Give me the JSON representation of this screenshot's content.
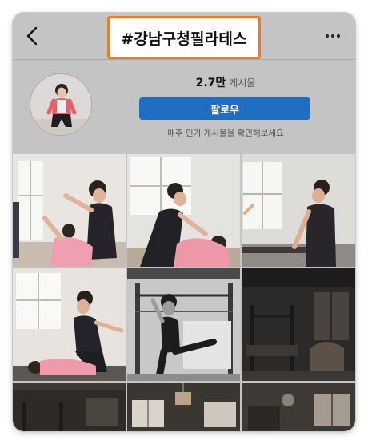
{
  "header": {
    "hashtag_title": "#강남구청필라테스",
    "back_icon": "chevron-left-icon",
    "more_icon": "more-horizontal-icon",
    "highlight_color": "#f47a20"
  },
  "profile": {
    "post_count": "2.7만",
    "post_label": "게시물",
    "follow_label": "팔로우",
    "subtitle": "매주 인기 게시물을 확인해보세요",
    "follow_color": "#1f6ec3"
  },
  "grid": {
    "posts": [
      {
        "subject": "instructor-assisting-arm-stretch"
      },
      {
        "subject": "instructor-pressing-back-stretch"
      },
      {
        "subject": "instructor-at-reformer"
      },
      {
        "subject": "assisted-lying-stretch"
      },
      {
        "subject": "cadillac-standing-exercise"
      },
      {
        "subject": "dark-studio-equipment"
      },
      {
        "subject": "dark-studio-windows"
      },
      {
        "subject": "studio-chandelier"
      },
      {
        "subject": "studio-window-light"
      }
    ]
  }
}
